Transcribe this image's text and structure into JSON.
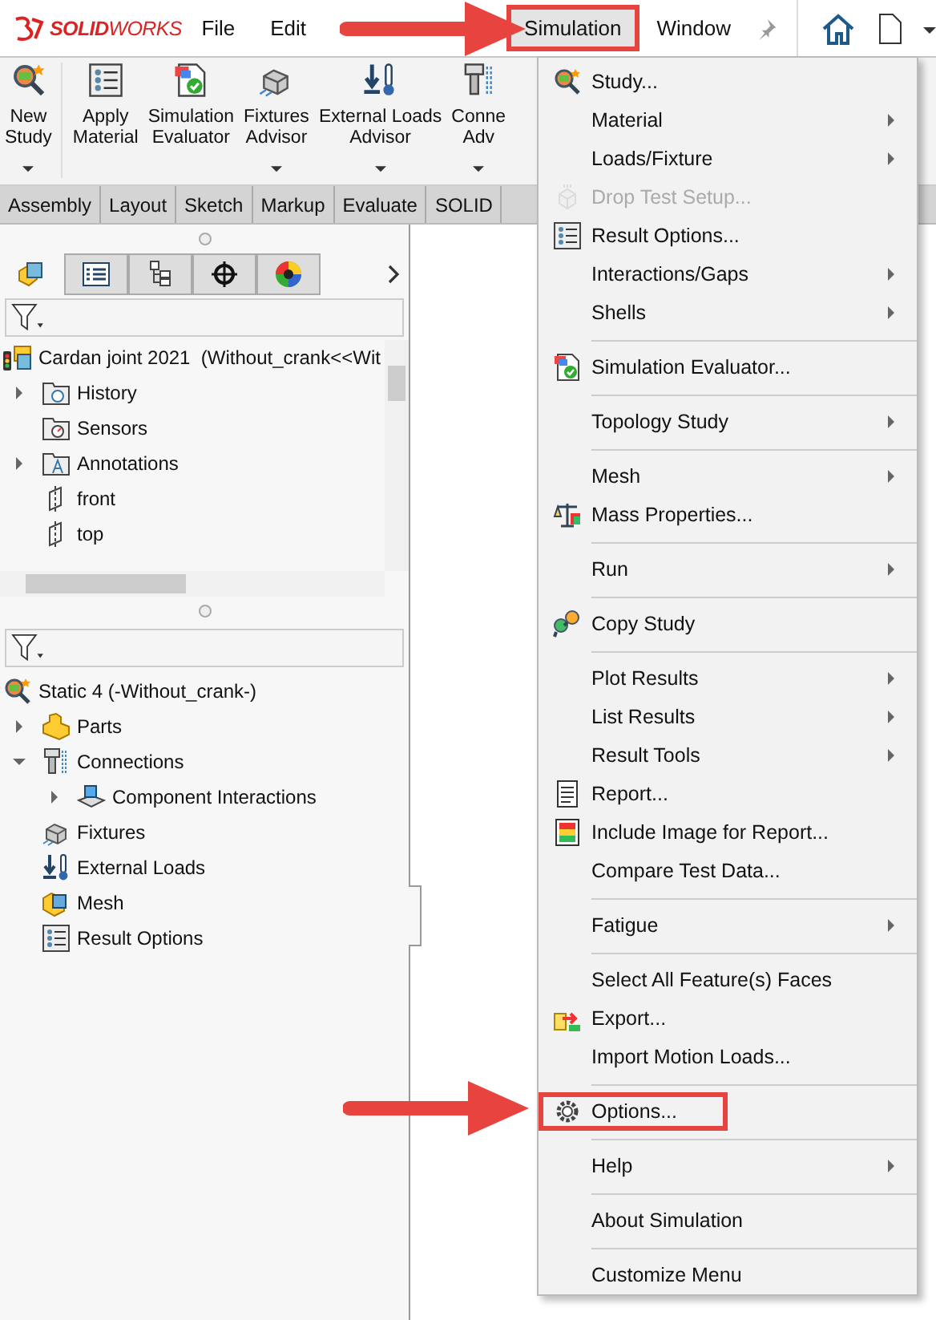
{
  "app": {
    "logo_bold": "SOLID",
    "logo_rest": "WORKS"
  },
  "menubar": [
    {
      "label": "File",
      "selected": false,
      "highlighted": false
    },
    {
      "label": "Edit",
      "selected": false,
      "highlighted": false
    },
    {
      "label": "Simulation",
      "selected": true,
      "highlighted": true
    },
    {
      "label": "Window",
      "selected": false,
      "highlighted": false
    }
  ],
  "ribbon": [
    {
      "lines": [
        "New",
        "Study"
      ],
      "dropdown": true
    },
    {
      "lines": [
        "Apply",
        "Material"
      ],
      "dropdown": false
    },
    {
      "lines": [
        "Simulation",
        "Evaluator"
      ],
      "dropdown": false
    },
    {
      "lines": [
        "Fixtures",
        "Advisor"
      ],
      "dropdown": true
    },
    {
      "lines": [
        "External Loads",
        "Advisor"
      ],
      "dropdown": true
    },
    {
      "lines": [
        "Conne",
        "Adv"
      ],
      "dropdown": true
    }
  ],
  "command_tabs": [
    {
      "label": "Assembly",
      "selected": false
    },
    {
      "label": "Layout",
      "selected": false
    },
    {
      "label": "Sketch",
      "selected": false
    },
    {
      "label": "Markup",
      "selected": false
    },
    {
      "label": "Evaluate",
      "selected": false
    },
    {
      "label": "SOLID",
      "selected": false
    }
  ],
  "panel_tabs": [
    {
      "selected": true
    },
    {
      "selected": false
    },
    {
      "selected": false
    },
    {
      "selected": false
    },
    {
      "selected": false
    }
  ],
  "feature_tree": {
    "label": "Cardan joint 2021  (Without_crank<<Wit",
    "children": [
      {
        "label": "History",
        "expanded": false
      },
      {
        "label": "Sensors"
      },
      {
        "label": "Annotations",
        "expanded": false
      },
      {
        "label": "front"
      },
      {
        "label": "top"
      }
    ]
  },
  "study_tree": {
    "label": "Static 4 (-Without_crank-)",
    "children": [
      {
        "label": "Parts",
        "expanded": false
      },
      {
        "label": "Connections",
        "expanded": true,
        "children": [
          {
            "label": "Component Interactions",
            "expanded": false
          }
        ]
      },
      {
        "label": "Fixtures"
      },
      {
        "label": "External Loads"
      },
      {
        "label": "Mesh"
      },
      {
        "label": "Result Options"
      }
    ]
  },
  "menu": [
    {
      "kind": "item",
      "label": "Study...",
      "submenu": false,
      "disabled": false,
      "highlighted": false
    },
    {
      "kind": "item",
      "label": "Material",
      "submenu": true,
      "disabled": false,
      "highlighted": false
    },
    {
      "kind": "item",
      "label": "Loads/Fixture",
      "submenu": true,
      "disabled": false,
      "highlighted": false
    },
    {
      "kind": "item",
      "label": "Drop Test Setup...",
      "submenu": false,
      "disabled": true,
      "highlighted": false
    },
    {
      "kind": "item",
      "label": "Result Options...",
      "submenu": false,
      "disabled": false,
      "highlighted": false
    },
    {
      "kind": "item",
      "label": "Interactions/Gaps",
      "submenu": true,
      "disabled": false,
      "highlighted": false
    },
    {
      "kind": "item",
      "label": "Shells",
      "submenu": true,
      "disabled": false,
      "highlighted": false
    },
    {
      "kind": "separator"
    },
    {
      "kind": "item",
      "label": "Simulation Evaluator...",
      "submenu": false,
      "disabled": false,
      "highlighted": false
    },
    {
      "kind": "separator"
    },
    {
      "kind": "item",
      "label": "Topology Study",
      "submenu": true,
      "disabled": false,
      "highlighted": false
    },
    {
      "kind": "separator"
    },
    {
      "kind": "item",
      "label": "Mesh",
      "submenu": true,
      "disabled": false,
      "highlighted": false
    },
    {
      "kind": "item",
      "label": "Mass Properties...",
      "submenu": false,
      "disabled": false,
      "highlighted": false
    },
    {
      "kind": "separator"
    },
    {
      "kind": "item",
      "label": "Run",
      "submenu": true,
      "disabled": false,
      "highlighted": false
    },
    {
      "kind": "separator"
    },
    {
      "kind": "item",
      "label": "Copy Study",
      "submenu": false,
      "disabled": false,
      "highlighted": false
    },
    {
      "kind": "separator"
    },
    {
      "kind": "item",
      "label": "Plot Results",
      "submenu": true,
      "disabled": false,
      "highlighted": false
    },
    {
      "kind": "item",
      "label": "List Results",
      "submenu": true,
      "disabled": false,
      "highlighted": false
    },
    {
      "kind": "item",
      "label": "Result Tools",
      "submenu": true,
      "disabled": false,
      "highlighted": false
    },
    {
      "kind": "item",
      "label": "Report...",
      "submenu": false,
      "disabled": false,
      "highlighted": false
    },
    {
      "kind": "item",
      "label": "Include Image for Report...",
      "submenu": false,
      "disabled": false,
      "highlighted": false
    },
    {
      "kind": "item",
      "label": "Compare Test Data...",
      "submenu": false,
      "disabled": false,
      "highlighted": false
    },
    {
      "kind": "separator"
    },
    {
      "kind": "item",
      "label": "Fatigue",
      "submenu": true,
      "disabled": false,
      "highlighted": false
    },
    {
      "kind": "separator"
    },
    {
      "kind": "item",
      "label": "Select All Feature(s) Faces",
      "submenu": false,
      "disabled": false,
      "highlighted": false
    },
    {
      "kind": "item",
      "label": "Export...",
      "submenu": false,
      "disabled": false,
      "highlighted": false
    },
    {
      "kind": "item",
      "label": "Import Motion Loads...",
      "submenu": false,
      "disabled": false,
      "highlighted": false
    },
    {
      "kind": "separator"
    },
    {
      "kind": "item",
      "label": "Options...",
      "submenu": false,
      "disabled": false,
      "highlighted": true
    },
    {
      "kind": "separator"
    },
    {
      "kind": "item",
      "label": "Help",
      "submenu": true,
      "disabled": false,
      "highlighted": false
    },
    {
      "kind": "separator"
    },
    {
      "kind": "item",
      "label": "About Simulation",
      "submenu": false,
      "disabled": false,
      "highlighted": false
    },
    {
      "kind": "separator"
    },
    {
      "kind": "item",
      "label": "Customize Menu",
      "submenu": false,
      "disabled": false,
      "highlighted": false
    }
  ]
}
